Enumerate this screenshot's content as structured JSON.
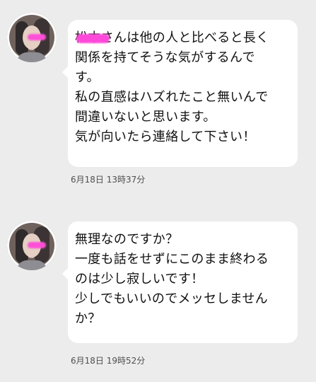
{
  "messages": [
    {
      "lines": [
        "松本さんは他の人と比べると長く",
        "関係を持てそうな気がするんで",
        "す。",
        "私の直感はハズれたこと無いんで",
        "間違いないと思います。",
        "気が向いたら連絡して下さい！"
      ],
      "timestamp": "6月18日 13時37分"
    },
    {
      "lines": [
        "無理なのですか？",
        "一度も話をせずにこのまま終わる",
        "のは少し寂しいです！",
        "少しでもいいのでメッセしません",
        "か？"
      ],
      "timestamp": "6月18日 19時52分"
    }
  ]
}
